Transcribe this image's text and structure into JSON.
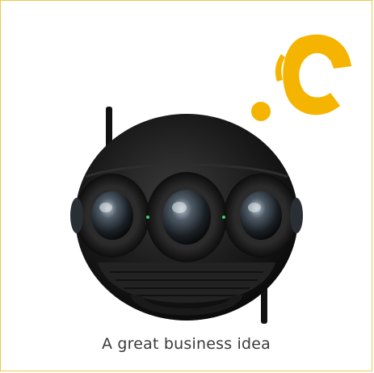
{
  "caption": "A great business idea",
  "colors": {
    "border": "#f2c94c",
    "logo": "#f5b400",
    "camera_body": "#151515"
  },
  "icons": {
    "logo": "yellow-c-logo-icon",
    "product": "360-camera-icon"
  }
}
